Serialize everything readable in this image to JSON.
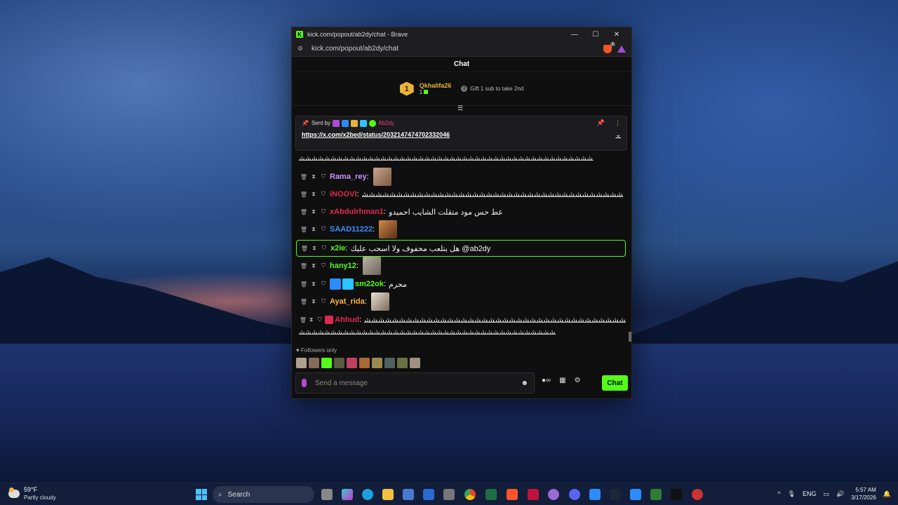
{
  "browser": {
    "title": "kick.com/popout/ab2dy/chat - Brave",
    "url": "kick.com/popout/ab2dy/chat",
    "shield_count": "1"
  },
  "chat": {
    "header": "Chat",
    "leader": {
      "rank": "1",
      "name": "Qkhalifa26",
      "count": "1"
    },
    "gift_text": "Gift 1 sub to take 2nd",
    "pinned": {
      "sent_by": "Sent by",
      "user": "Ab2dy",
      "link": "https://x.com/x2bed/status/2032147474702332046"
    },
    "top_line": "ﺸﺸﺸﺸﺸﺸﺸﺸﺸﺸﺸﺸﺸﺸﺸﺸﺸﺸﺸﺸﺸﺸﺸﺸﺸﺸﺸﺸﺸﺸﺸﺸﺸﺸﺸﺸﺸﺸﺸﺸﺸﺸﺸﺸﺸﺸﺸ",
    "messages": [
      {
        "user": "Rama_rey",
        "color": "#c792ff",
        "text": ""
      },
      {
        "user": "iNOOVI",
        "color": "#e0284f",
        "text": "ﺸﺸﺸﺸﺸﺸﺸﺸﺸﺸﺸﺸﺸﺸﺸﺸﺸﺸﺸﺸﺸﺸﺸﺸﺸﺸﺸﺸﺸﺸﺸﺸﺸﺸﺸﺸﺸﺸ"
      },
      {
        "user": "xAbdulrhman1",
        "color": "#e0284f",
        "text": "عط حس مود متقلت الشايب احميدو"
      },
      {
        "user": "SAAD11222",
        "color": "#3f8cff",
        "text": ""
      },
      {
        "user": "x2ie",
        "color": "#53fc18",
        "text": "هل بتلعب محفوف ولا اسحب عليك @ab2dy"
      },
      {
        "user": "hany12",
        "color": "#53fc18",
        "text": ""
      },
      {
        "user": "sm22ok",
        "color": "#53fc18",
        "text": "محرم"
      },
      {
        "user": "Ayat_rida",
        "color": "#ffb347",
        "text": ""
      },
      {
        "user": "Ahhud",
        "color": "#e0284f",
        "text": "ﺸﺸﺸﺸﺸﺸﺸﺸﺸﺸﺸﺸﺸﺸﺸﺸﺸﺸﺸﺸﺸﺸﺸﺸﺸﺸﺸﺸﺸﺸﺸﺸﺸﺸﺸﺸﺸﺸﺸﺸﺸﺸﺸﺸﺸ"
      }
    ],
    "bottom_line": "ﺸﺸﺸﺸﺸﺸﺸﺸﺸﺸﺸﺸﺸﺸﺸﺸﺸﺸﺸﺸﺸﺸﺸﺸﺸﺸﺸﺸﺸﺸﺸﺸﺸﺸﺸﺸﺸﺸﺸﺸﺸ",
    "mode": "Followers only",
    "input_placeholder": "Send a message",
    "send_label": "Chat"
  },
  "taskbar": {
    "temp": "59°F",
    "weather": "Partly cloudy",
    "search": "Search",
    "lang": "ENG",
    "time": "5:57 AM",
    "date": "3/17/2026"
  }
}
